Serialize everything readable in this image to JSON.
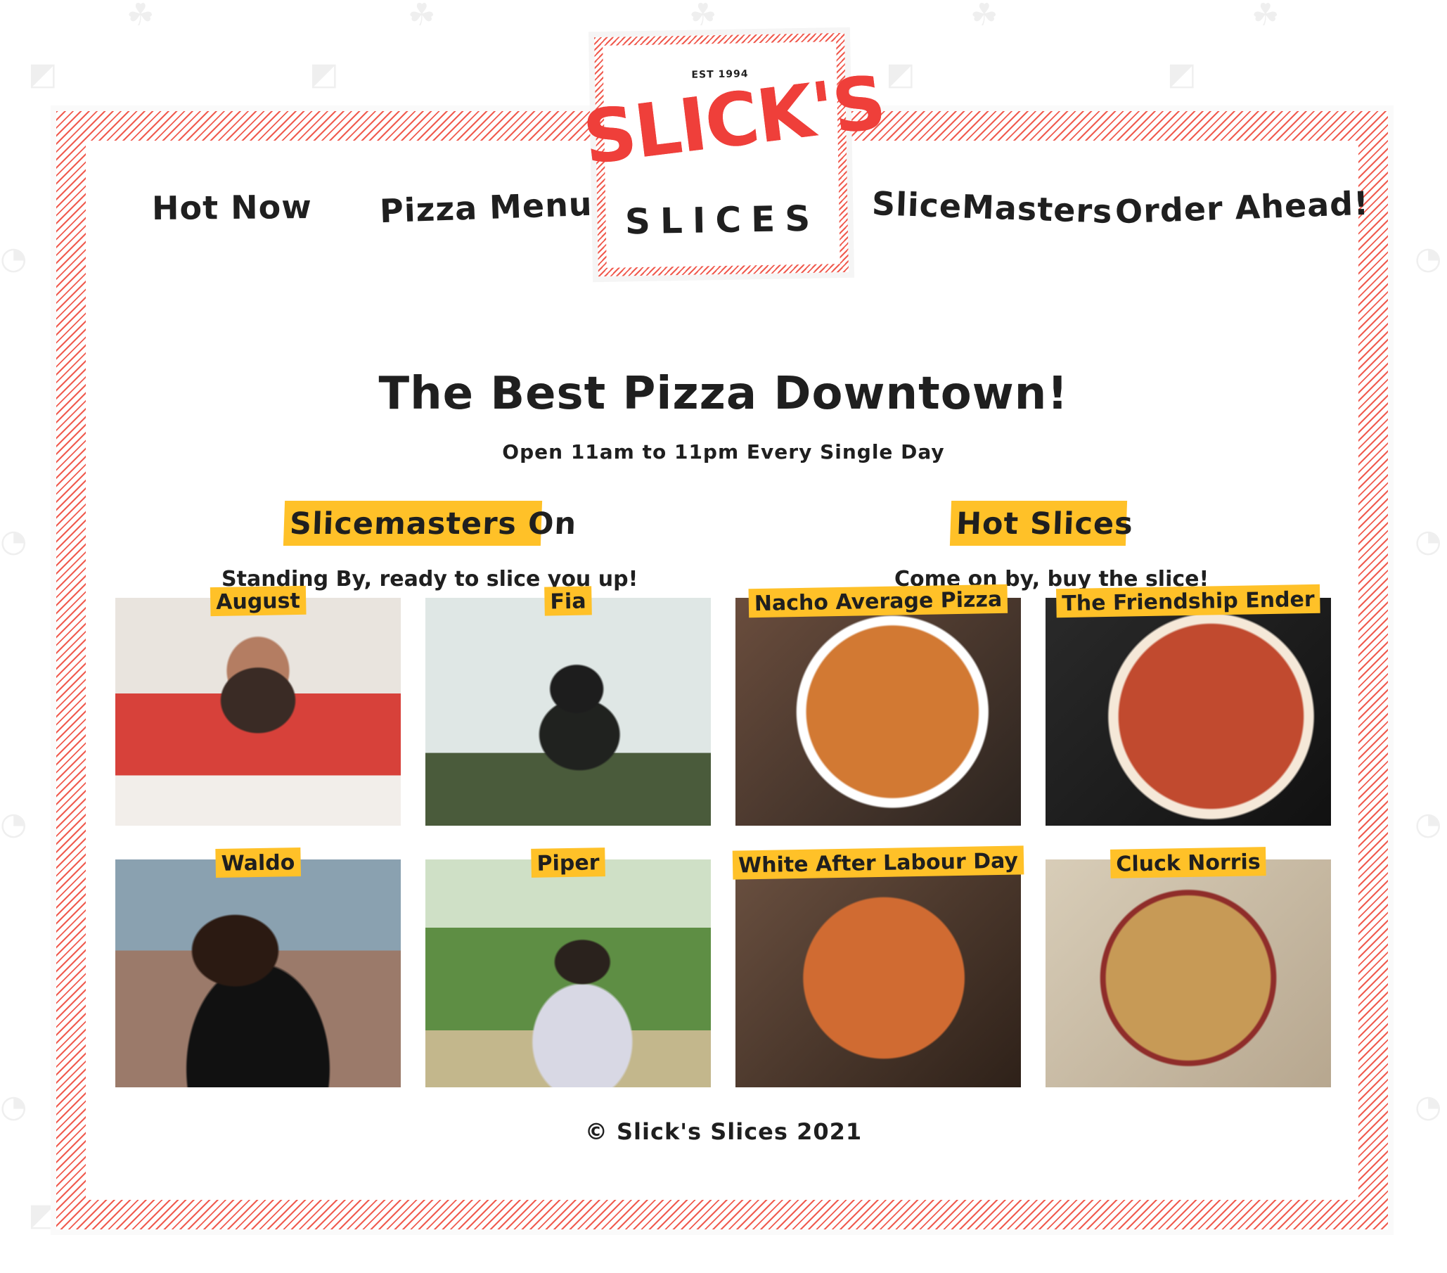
{
  "brand": {
    "est": "EST 1994",
    "name_top": "SLICK'S",
    "name_bottom": "SLICES"
  },
  "nav": {
    "items": [
      {
        "label": "Hot Now"
      },
      {
        "label": "Pizza Menu"
      },
      {
        "label": "SliceMasters"
      },
      {
        "label": "Order Ahead!"
      }
    ]
  },
  "hero": {
    "title": "The Best Pizza Downtown!",
    "subtitle": "Open 11am to 11pm Every Single Day"
  },
  "slicemasters": {
    "heading": "Slicemasters On",
    "subheading": "Standing By, ready to slice you up!",
    "people": [
      {
        "name": "August"
      },
      {
        "name": "Fia"
      },
      {
        "name": "Waldo"
      },
      {
        "name": "Piper"
      }
    ]
  },
  "hot_slices": {
    "heading": "Hot Slices",
    "subheading": "Come on by, buy the slice!",
    "pizzas": [
      {
        "name": "Nacho Average Pizza"
      },
      {
        "name": "The Friendship Ender"
      },
      {
        "name": "White After Labour Day"
      },
      {
        "name": "Cluck Norris"
      }
    ]
  },
  "footer": {
    "text": "© Slick's Slices 2021"
  },
  "colors": {
    "accent_red": "#ef3f3a",
    "accent_yellow": "#ffc128",
    "text_dark": "#1f1f1f"
  }
}
